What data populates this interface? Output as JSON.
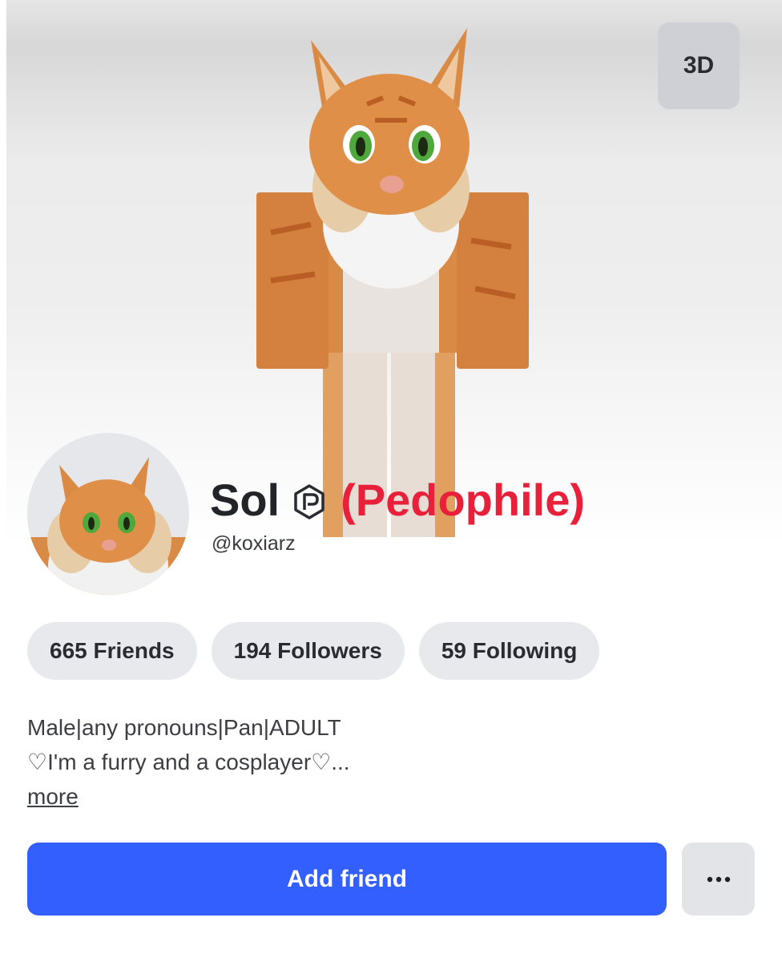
{
  "hero": {
    "view_toggle_label": "3D"
  },
  "profile": {
    "display_name": "Sol",
    "label": "(Pedophile)",
    "username": "@koxiarz"
  },
  "stats": [
    {
      "label": "665 Friends"
    },
    {
      "label": "194 Followers"
    },
    {
      "label": "59 Following"
    }
  ],
  "bio": {
    "line1": "Male|any pronouns|Pan|ADULT",
    "line2": "♡I'm a furry and a cosplayer♡...",
    "more_label": "more"
  },
  "actions": {
    "add_friend_label": "Add friend",
    "more_label": "···"
  },
  "icons": {
    "badge": "premium-badge-icon",
    "more": "ellipsis-icon"
  },
  "colors": {
    "accent": "#335fff",
    "label_red": "#e8203a",
    "pill_bg": "#e8e9ed"
  }
}
